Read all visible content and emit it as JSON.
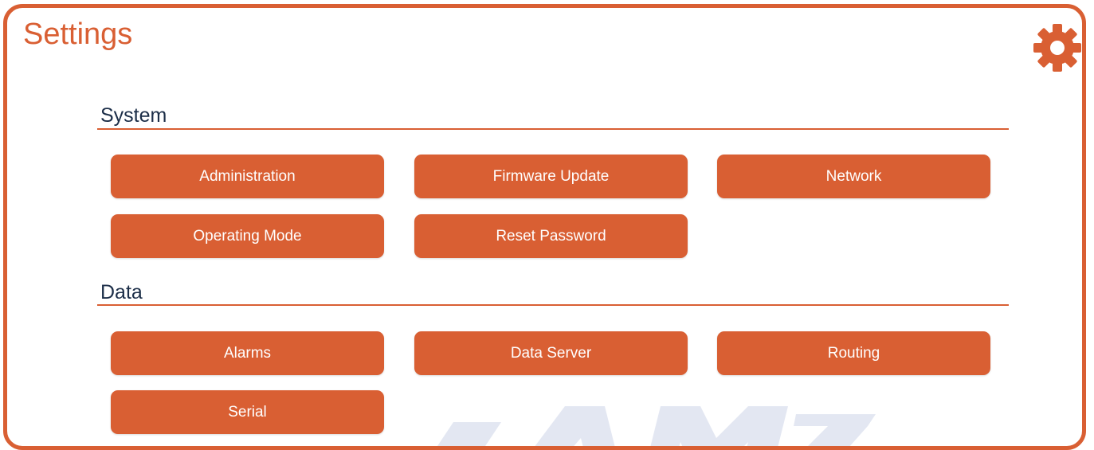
{
  "colors": {
    "accent": "#d95f33",
    "section_heading": "#1c2e48",
    "button_text": "#ffffff",
    "watermark": "#e3e7f2"
  },
  "header": {
    "title": "Settings",
    "settings_icon": "gear-icon"
  },
  "sections": {
    "system": {
      "title": "System",
      "buttons": [
        "Administration",
        "Firmware Update",
        "Network",
        "Operating Mode",
        "Reset Password"
      ]
    },
    "data": {
      "title": "Data",
      "buttons": [
        "Alarms",
        "Data Server",
        "Routing",
        "Serial"
      ]
    }
  }
}
